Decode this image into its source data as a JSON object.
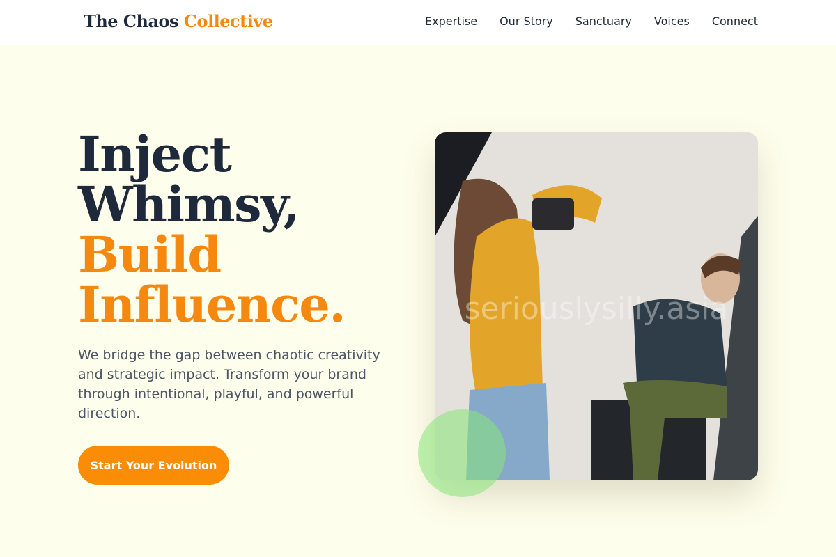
{
  "header": {
    "logo_main": "The Chaos",
    "logo_accent": "Collective",
    "nav": [
      {
        "label": "Expertise"
      },
      {
        "label": "Our Story"
      },
      {
        "label": "Sanctuary"
      },
      {
        "label": "Voices"
      },
      {
        "label": "Connect"
      }
    ]
  },
  "hero": {
    "headline_lines": [
      "Inject",
      "Whimsy,",
      "Build",
      "Influence."
    ],
    "lead": "We bridge the gap between chaotic creativity and strategic impact. Transform your brand through intentional, playful, and powerful direction.",
    "cta_label": "Start Your Evolution"
  },
  "image": {
    "watermark": "seriouslysilly.asia",
    "alt": "photographer photographing a man sitting on a box"
  },
  "colors": {
    "accent": "#f5890f",
    "background": "#fefeec",
    "text": "#1e293b",
    "green_blob": "#86e678"
  }
}
